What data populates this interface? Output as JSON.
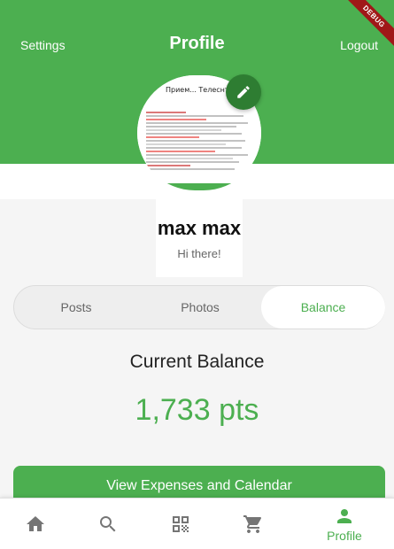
{
  "header": {
    "settings_label": "Settings",
    "title": "Profile",
    "logout_label": "Logout",
    "debug_badge": "DEBUG"
  },
  "profile": {
    "name": "max max",
    "bio": "Hi there!",
    "avatar_heading": "Прием... Телеснтре"
  },
  "tabs": [
    {
      "label": "Posts",
      "selected": false
    },
    {
      "label": "Photos",
      "selected": false
    },
    {
      "label": "Balance",
      "selected": true
    }
  ],
  "balance": {
    "title": "Current Balance",
    "value": "1,733 pts"
  },
  "actions": {
    "view_expenses_label": "View Expenses and Calendar"
  },
  "bottom_nav": {
    "items": [
      {
        "icon": "home-icon",
        "label": ""
      },
      {
        "icon": "search-icon",
        "label": ""
      },
      {
        "icon": "qr-code-icon",
        "label": ""
      },
      {
        "icon": "cart-icon",
        "label": ""
      },
      {
        "icon": "person-icon",
        "label": "Profile",
        "selected": true
      }
    ]
  },
  "colors": {
    "primary": "#4caf50",
    "primary_dark": "#2e7d32",
    "inactive_icon": "#757575",
    "background": "#f5f5f5"
  }
}
